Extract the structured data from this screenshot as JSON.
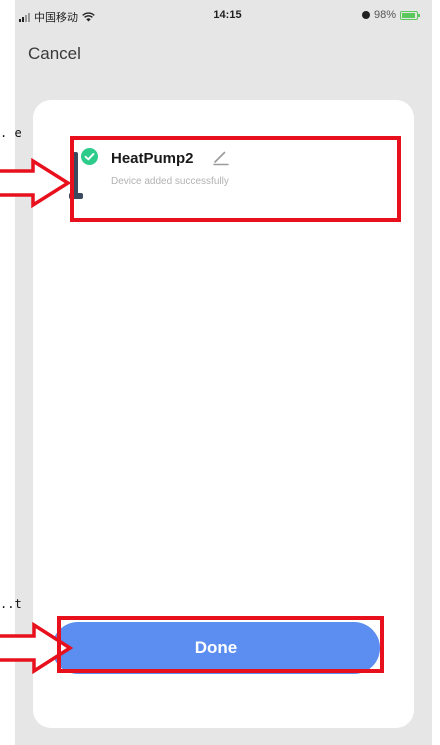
{
  "status_bar": {
    "carrier": "中国移动",
    "time": "14:15",
    "battery": "98%"
  },
  "header": {
    "cancel_label": "Cancel"
  },
  "device": {
    "name": "HeatPump2",
    "status": "Device added successfully"
  },
  "footer": {
    "done_label": "Done"
  },
  "annotations": {
    "label_top": ". e",
    "label_bottom": "..t"
  },
  "colors": {
    "accent": "#5b8ef0",
    "success": "#2ecc8a",
    "highlight": "#e8101c",
    "background": "#e6e6e6"
  },
  "icons": [
    "signal-icon",
    "wifi-icon",
    "alarm-icon",
    "battery-icon",
    "success-check-icon",
    "edit-pencil-icon",
    "device-image"
  ]
}
